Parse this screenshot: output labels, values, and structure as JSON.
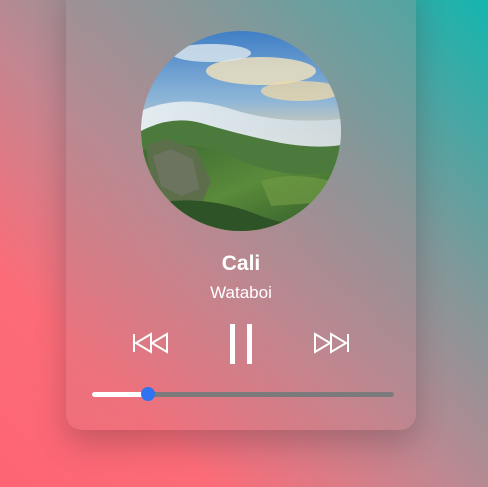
{
  "track": {
    "title": "Cali",
    "artist": "Wataboi",
    "cover_image": "landscape-cover-art"
  },
  "controls": {
    "previous_icon": "skip-back-icon",
    "play_state": "playing",
    "pause_icon": "pause-icon",
    "next_icon": "skip-forward-icon"
  },
  "progress": {
    "fraction": 0.185
  },
  "colors": {
    "accent": "#2f73f0",
    "track_bg": "#7d7a7c",
    "text": "#ffffff",
    "gradient_top_right": "#13b5ae",
    "gradient_bottom_left": "#ff6474"
  }
}
